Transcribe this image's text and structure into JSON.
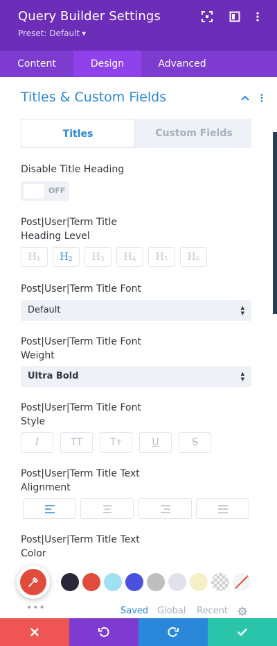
{
  "header": {
    "title": "Query Builder Settings",
    "preset": "Preset: Default",
    "icons": [
      "fullscreen-icon",
      "sidebar-toggle-icon",
      "more-options-icon"
    ]
  },
  "tabs": [
    {
      "label": "Content",
      "active": false
    },
    {
      "label": "Design",
      "active": true
    },
    {
      "label": "Advanced",
      "active": false
    }
  ],
  "section": {
    "title": "Titles & Custom Fields",
    "expanded": true
  },
  "subtabs": {
    "titles": "Titles",
    "custom_fields": "Custom Fields",
    "active": "titles"
  },
  "disable_heading": {
    "label": "Disable Title Heading",
    "toggle_text": "OFF",
    "value": false
  },
  "heading_level": {
    "label_line1": "Post|User|Term Title",
    "label_line2": "Heading Level",
    "options": [
      {
        "letter": "H",
        "num": "1"
      },
      {
        "letter": "H",
        "num": "2"
      },
      {
        "letter": "H",
        "num": "3"
      },
      {
        "letter": "H",
        "num": "4"
      },
      {
        "letter": "H",
        "num": "5"
      },
      {
        "letter": "H",
        "num": "6"
      }
    ],
    "selected": "H2"
  },
  "title_font": {
    "label": "Post|User|Term Title Font",
    "value": "Default"
  },
  "font_weight": {
    "label_line1": "Post|User|Term Title Font",
    "label_line2": "Weight",
    "value": "Ultra Bold"
  },
  "font_style": {
    "label_line1": "Post|User|Term Title Font",
    "label_line2": "Style",
    "buttons": [
      "I",
      "TT",
      "Tт",
      "U",
      "S"
    ]
  },
  "text_alignment": {
    "label_line1": "Post|User|Term Title Text",
    "label_line2": "Alignment",
    "options": [
      "left",
      "center",
      "right",
      "justify"
    ],
    "selected": "left"
  },
  "text_color": {
    "label_line1": "Post|User|Term Title Text",
    "label_line2": "Color",
    "swatches": [
      "#282838",
      "#e04c3c",
      "#9fe0f2",
      "#4a52dd",
      "#bebebe",
      "#e1e1ec",
      "#f4efc4",
      "transparent",
      "none"
    ]
  },
  "palette_tabs": {
    "saved": "Saved",
    "global": "Global",
    "recent": "Recent",
    "active": "saved",
    "more": "•••"
  },
  "bottom_bar": {
    "colors": {
      "cancel": "#ef5555",
      "undo": "#7e3bd0",
      "redo": "#2b87da",
      "save": "#29c4a9"
    }
  },
  "colors": {
    "header_bg": "#6c2eb9",
    "tabs_bg": "#7d3bcf",
    "active_tab_bg": "#8f42ec",
    "accent": "#2b87da"
  }
}
